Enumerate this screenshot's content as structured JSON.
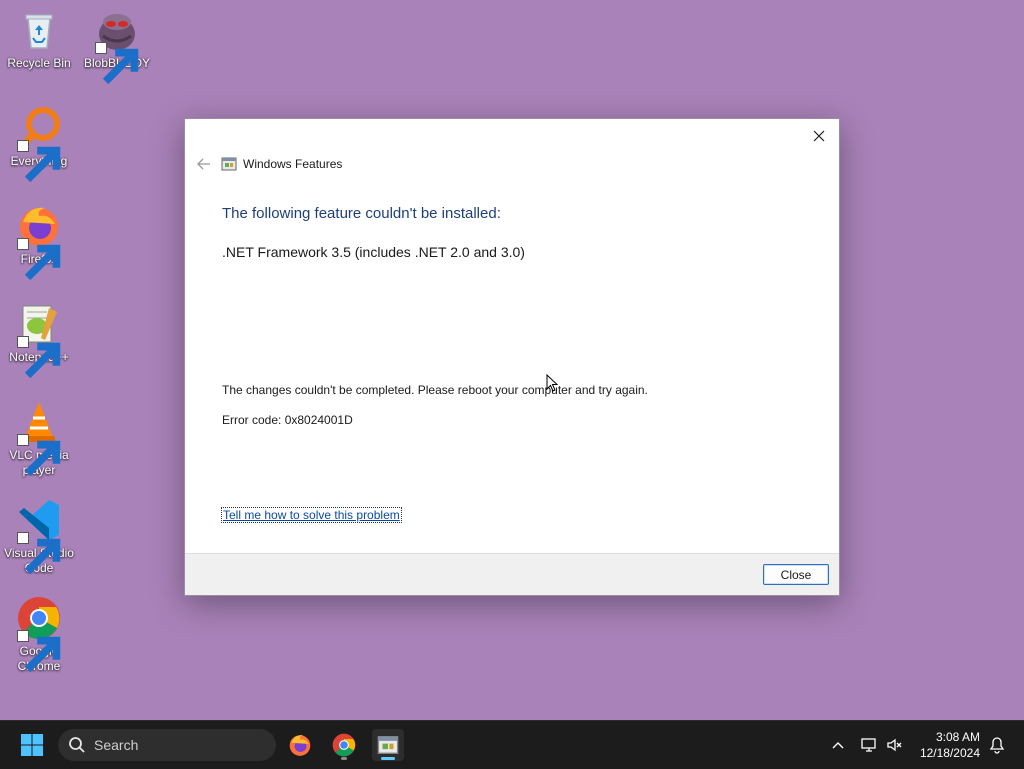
{
  "desktop": {
    "icons": [
      {
        "label": "Recycle Bin",
        "icon": "recycle-bin-icon"
      },
      {
        "label": "BlobBUDDY",
        "icon": "blobbuddy-icon"
      },
      {
        "label": "Everything",
        "icon": "everything-search-icon"
      },
      {
        "label": "Firefox",
        "icon": "firefox-icon"
      },
      {
        "label": "Notepad++",
        "icon": "notepadpp-icon"
      },
      {
        "label": "VLC media player",
        "icon": "vlc-icon"
      },
      {
        "label": "Visual Studio Code",
        "icon": "vscode-icon"
      },
      {
        "label": "Google Chrome",
        "icon": "chrome-icon"
      }
    ]
  },
  "dialog": {
    "window_title": "Windows Features",
    "heading": "The following feature couldn't be installed:",
    "feature": ".NET Framework 3.5 (includes .NET 2.0 and 3.0)",
    "message": "The changes couldn't be completed. Please reboot your computer and try again.",
    "error_code": "Error code: 0x8024001D",
    "help_link": "Tell me how to solve this problem",
    "close_button": "Close"
  },
  "taskbar": {
    "search_placeholder": "Search",
    "time": "3:08 AM",
    "date": "12/18/2024"
  },
  "colors": {
    "desktop_bg": "#a982b9",
    "heading": "#1e3f7a",
    "link": "#0a4aa6",
    "taskbar_bg": "#1c1c1c",
    "accent": "#60cdff"
  }
}
